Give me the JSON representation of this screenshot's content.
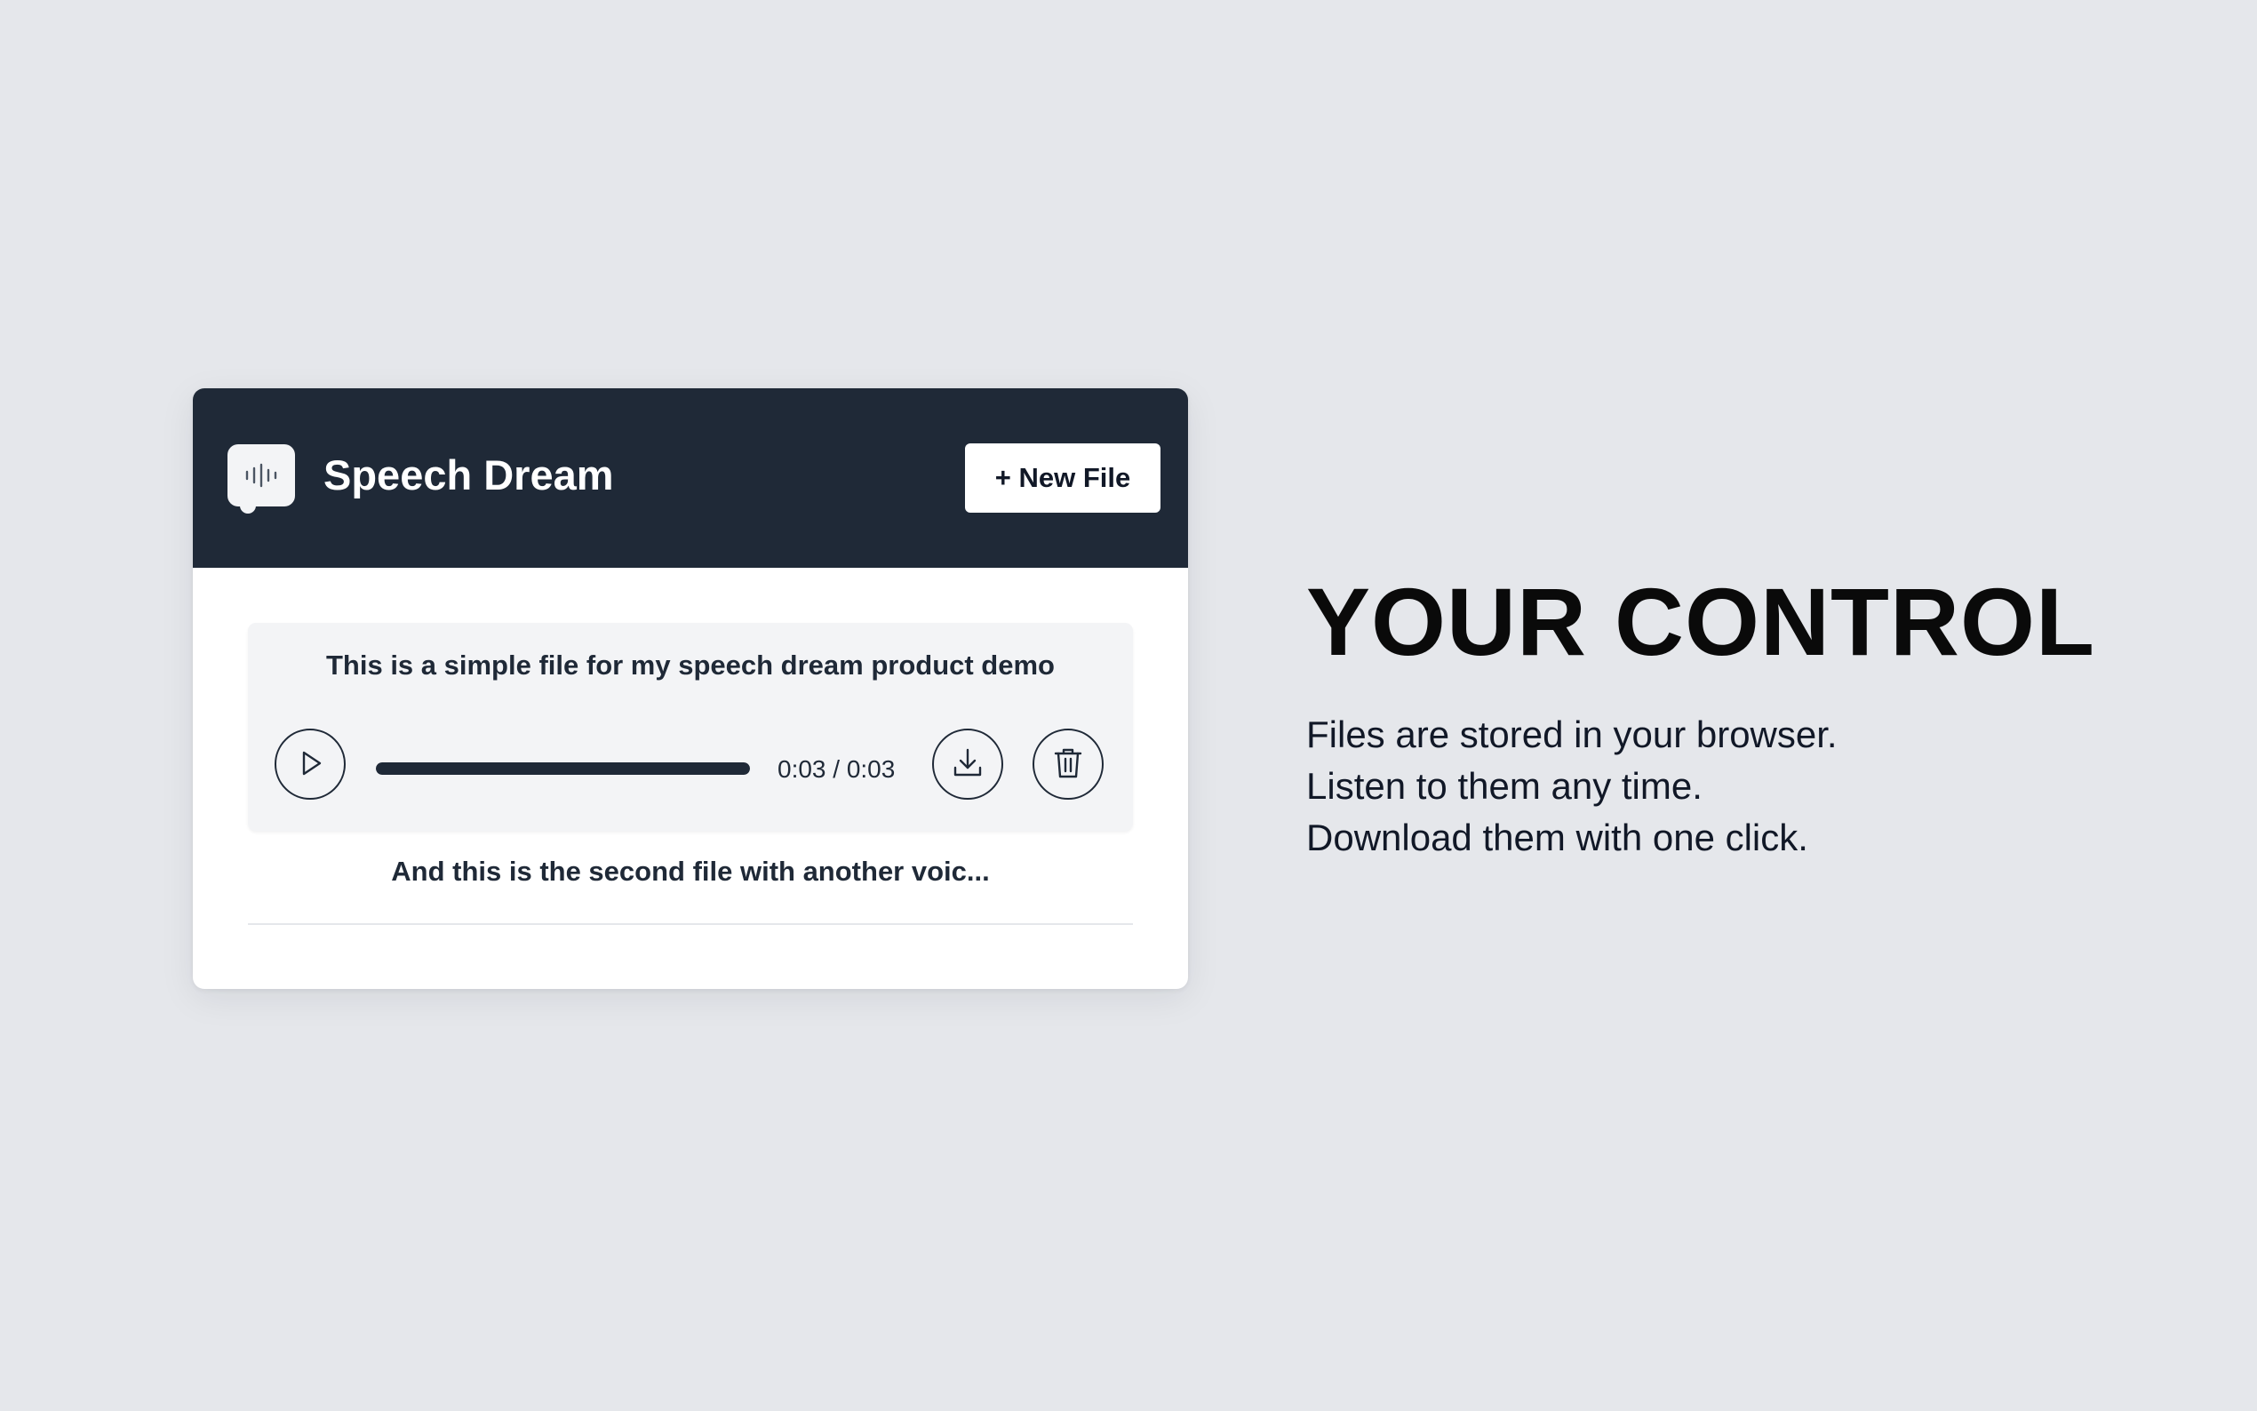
{
  "app": {
    "title": "Speech Dream",
    "new_file_label": "+ New File",
    "logo_icon": "waveform-icon"
  },
  "files": [
    {
      "title": "This is a simple file for my speech dream product demo",
      "time": "0:03 / 0:03",
      "progress": 1.0,
      "play_icon": "play-icon",
      "download_icon": "download-icon",
      "delete_icon": "trash-icon"
    },
    {
      "title": "And this is the second file with another voic..."
    }
  ],
  "feature": {
    "heading": "YOUR CONTROL",
    "lines": [
      "Files are stored in your browser.",
      "Listen to them any time.",
      "Download them with one click."
    ]
  },
  "colors": {
    "background": "#e5e7eb",
    "header": "#1f2937",
    "card": "#ffffff",
    "file_item": "#f3f4f6",
    "accent_dark": "#1f2937"
  }
}
